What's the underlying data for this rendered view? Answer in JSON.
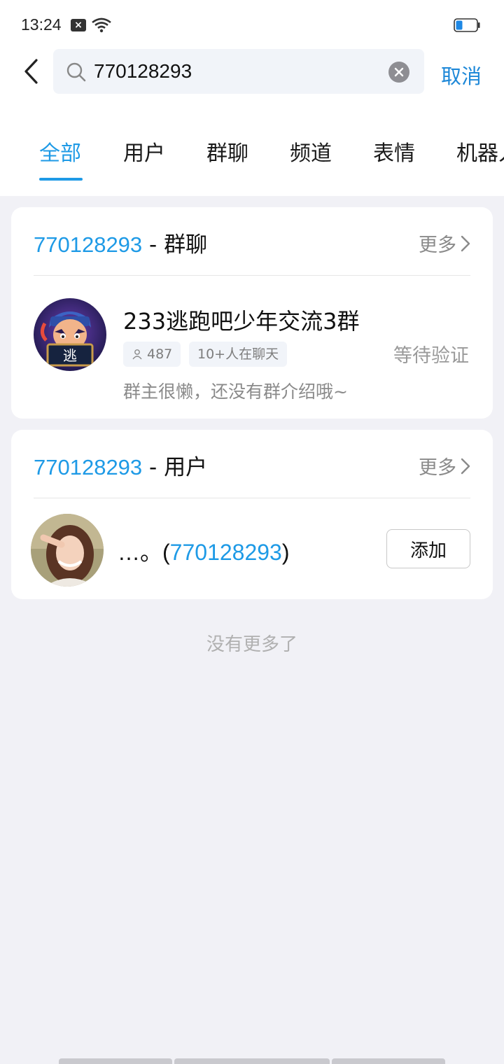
{
  "status_bar": {
    "time": "13:24"
  },
  "search": {
    "value": "770128293",
    "cancel_label": "取消"
  },
  "tabs": [
    {
      "label": "全部",
      "active": true
    },
    {
      "label": "用户"
    },
    {
      "label": "群聊"
    },
    {
      "label": "频道"
    },
    {
      "label": "表情"
    },
    {
      "label": "机器人"
    }
  ],
  "group_section": {
    "query": "770128293",
    "title_suffix": " - 群聊",
    "more_label": "更多",
    "result": {
      "name": "233逃跑吧少年交流3群",
      "member_count": "487",
      "chat_badge": "10+人在聊天",
      "status": "等待验证",
      "description": "群主很懒，还没有群介绍哦~",
      "avatar_text": "逃"
    }
  },
  "user_section": {
    "query": "770128293",
    "title_suffix": " - 用户",
    "more_label": "更多",
    "result": {
      "nickname": "…。",
      "id_open": "(",
      "id": "770128293",
      "id_close": ")",
      "add_label": "添加"
    }
  },
  "footer": {
    "no_more_text": "没有更多了"
  },
  "colors": {
    "accent": "#1e9ae6",
    "background": "#f1f1f6",
    "card": "#ffffff"
  }
}
